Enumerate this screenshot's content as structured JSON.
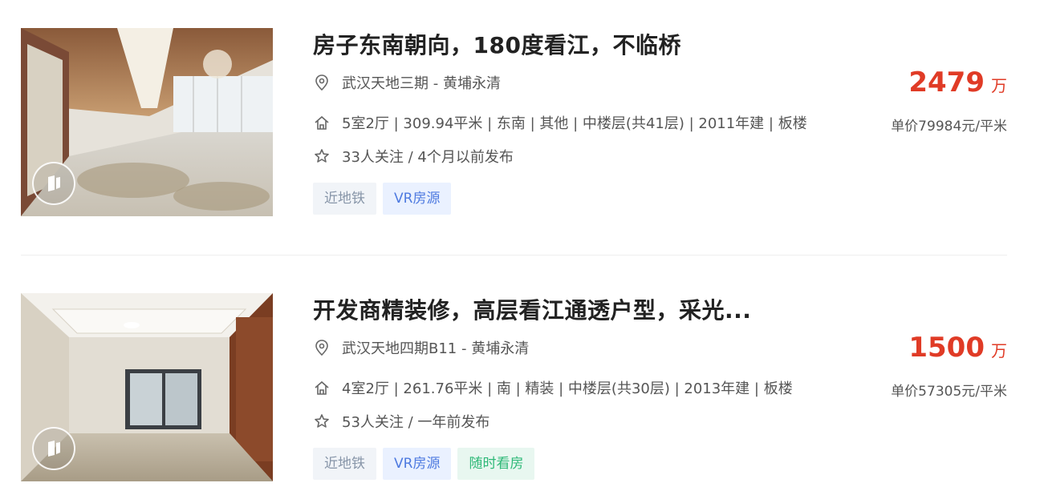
{
  "listings": [
    {
      "title": "房子东南朝向，180度看江，不临桥",
      "location": "武汉天地三期 - 黄埔永清",
      "house_info": "5室2厅 | 309.94平米 | 东南 | 其他 | 中楼层(共41层) | 2011年建 | 板楼",
      "follow_info": "33人关注 / 4个月以前发布",
      "tags": [
        "近地铁",
        "VR房源"
      ],
      "total_price": "2479",
      "total_price_unit": "万",
      "unit_price": "单价79984元/平米"
    },
    {
      "title": "开发商精装修，高层看江通透户型，采光...",
      "location": "武汉天地四期B11 - 黄埔永清",
      "house_info": "4室2厅 | 261.76平米 | 南 | 精装 | 中楼层(共30层) | 2013年建 | 板楼",
      "follow_info": "53人关注 / 一年前发布",
      "tags": [
        "近地铁",
        "VR房源",
        "随时看房"
      ],
      "total_price": "1500",
      "total_price_unit": "万",
      "unit_price": "单价57305元/平米"
    }
  ],
  "colors": {
    "price": "#e03b26",
    "tag_subway": "#8795a8",
    "tag_vr": "#4e7ae0",
    "tag_anytime": "#2fb978"
  },
  "icons": {
    "location": "map-pin-icon",
    "house": "house-icon",
    "follow": "star-icon",
    "vr_badge": "vr-logo-icon"
  }
}
